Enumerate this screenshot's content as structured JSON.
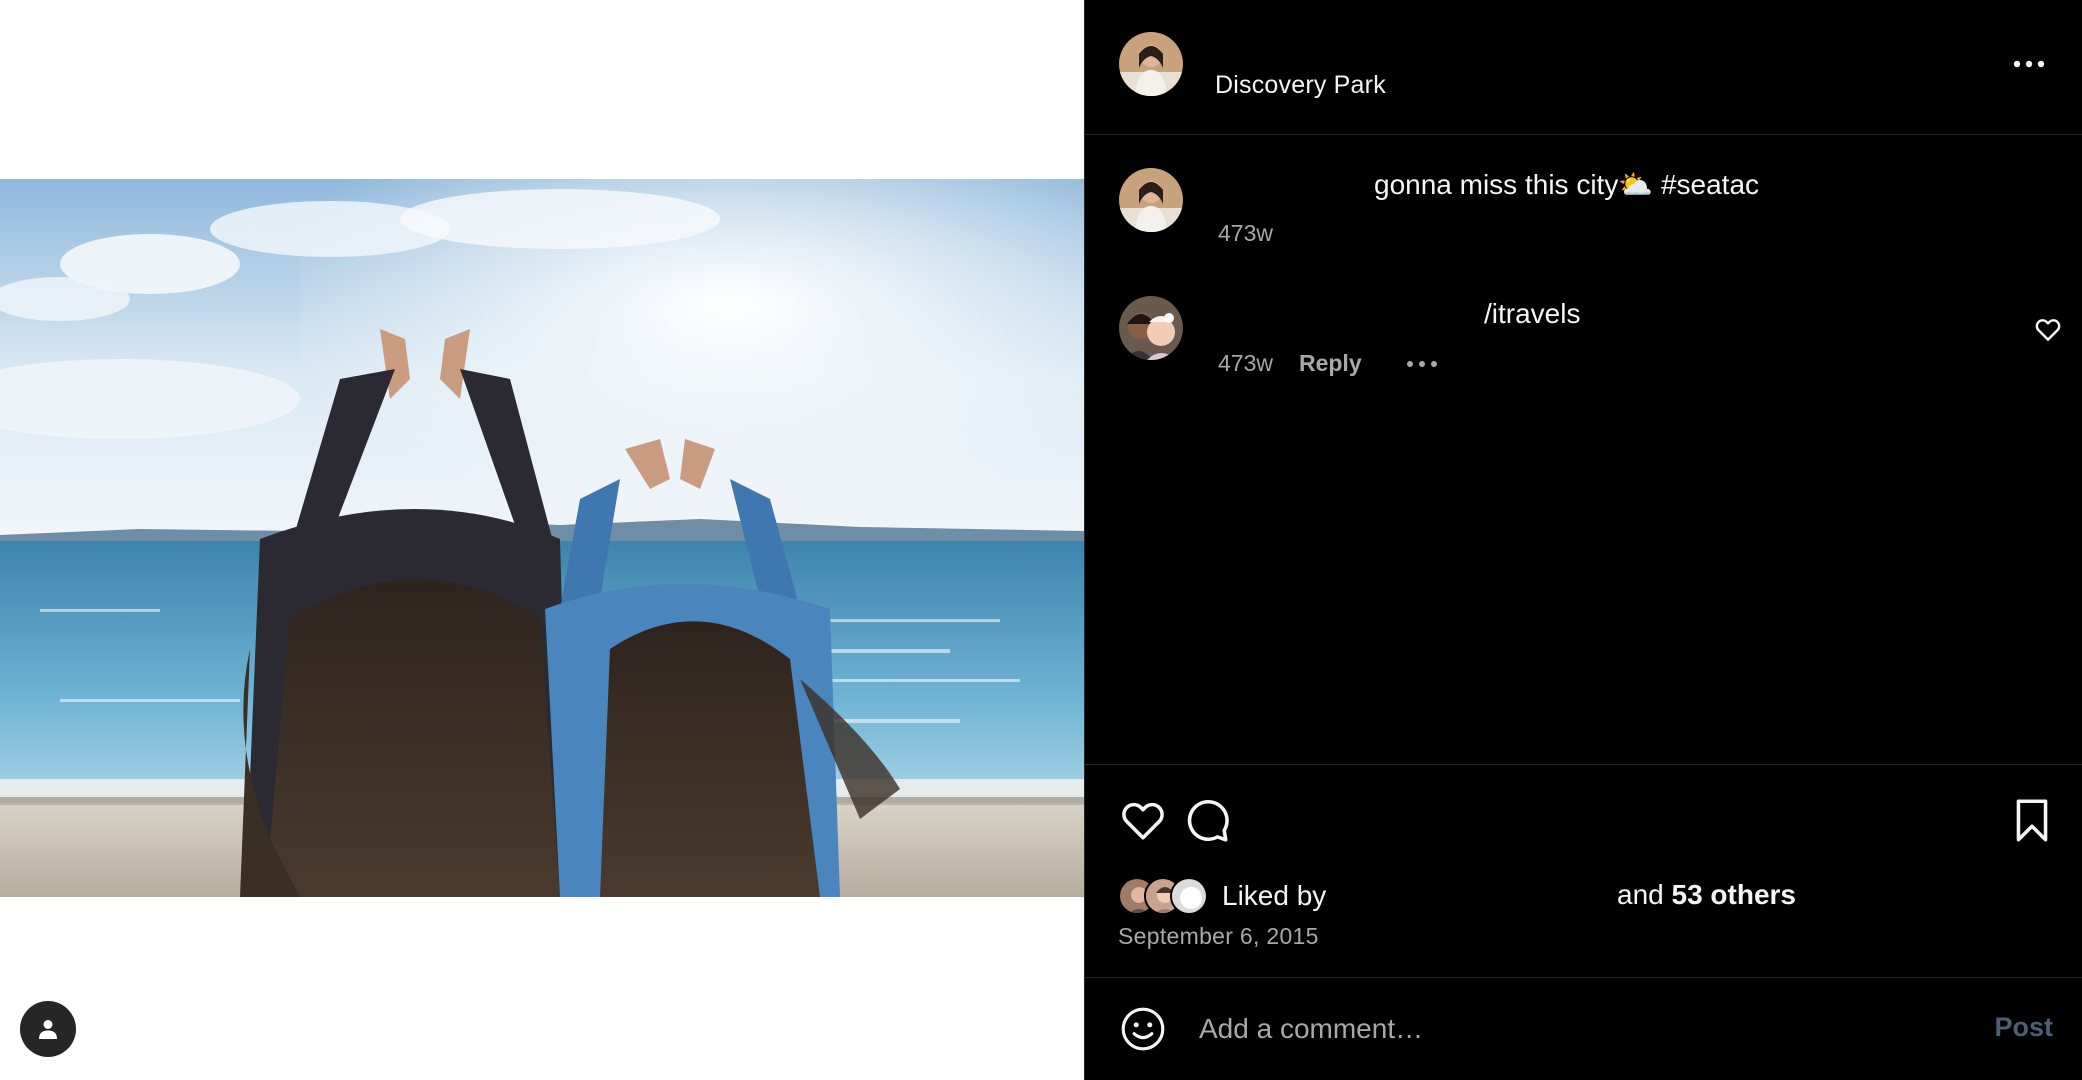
{
  "post": {
    "location": "Discovery Park",
    "caption": "gonna miss this city⛅ #seatac",
    "caption_age": "473w",
    "like_count_label": "53 others",
    "likes_prefix": "Liked by ",
    "likes_middle": "and ",
    "date": "September 6, 2015"
  },
  "comment": {
    "username_fragment": "/itravels",
    "age": "473w",
    "reply_label": "Reply"
  },
  "composer": {
    "placeholder": "Add a comment…",
    "post_label": "Post"
  },
  "colors": {
    "panel_bg": "#000000",
    "text_primary": "#f5f5f5",
    "text_secondary": "#a8a8a8",
    "post_button_disabled": "#4d5f75",
    "divider": "#262626"
  },
  "icons": {
    "more": "more-horizontal-icon",
    "heart": "heart-icon",
    "comment": "comment-bubble-icon",
    "bookmark": "bookmark-icon",
    "emoji": "emoji-smile-icon",
    "user_tag": "person-icon"
  }
}
